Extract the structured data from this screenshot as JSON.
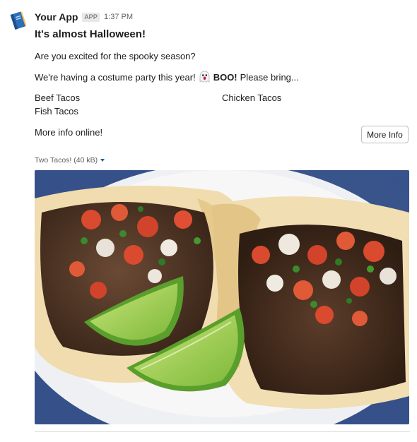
{
  "header": {
    "app_name": "Your App",
    "badge": "APP",
    "time": "1:37 PM"
  },
  "message": {
    "title": "It's almost Halloween!",
    "line1": "Are you excited for the spooky season?",
    "line2_before": "We're having a costume party this year!",
    "line2_emoji": "ghost-emoji",
    "line2_bold": "BOO!",
    "line2_after": "Please bring..."
  },
  "fields": [
    "Beef Tacos",
    "Chicken Tacos",
    "Fish Tacos"
  ],
  "more": {
    "text": "More info online!",
    "button": "More Info"
  },
  "attachment": {
    "label": "Two Tacos! (40 kB)",
    "image": "tacos-photo"
  },
  "colors": {
    "text": "#1d1c1d",
    "muted": "#616061",
    "link": "#1264a3"
  }
}
